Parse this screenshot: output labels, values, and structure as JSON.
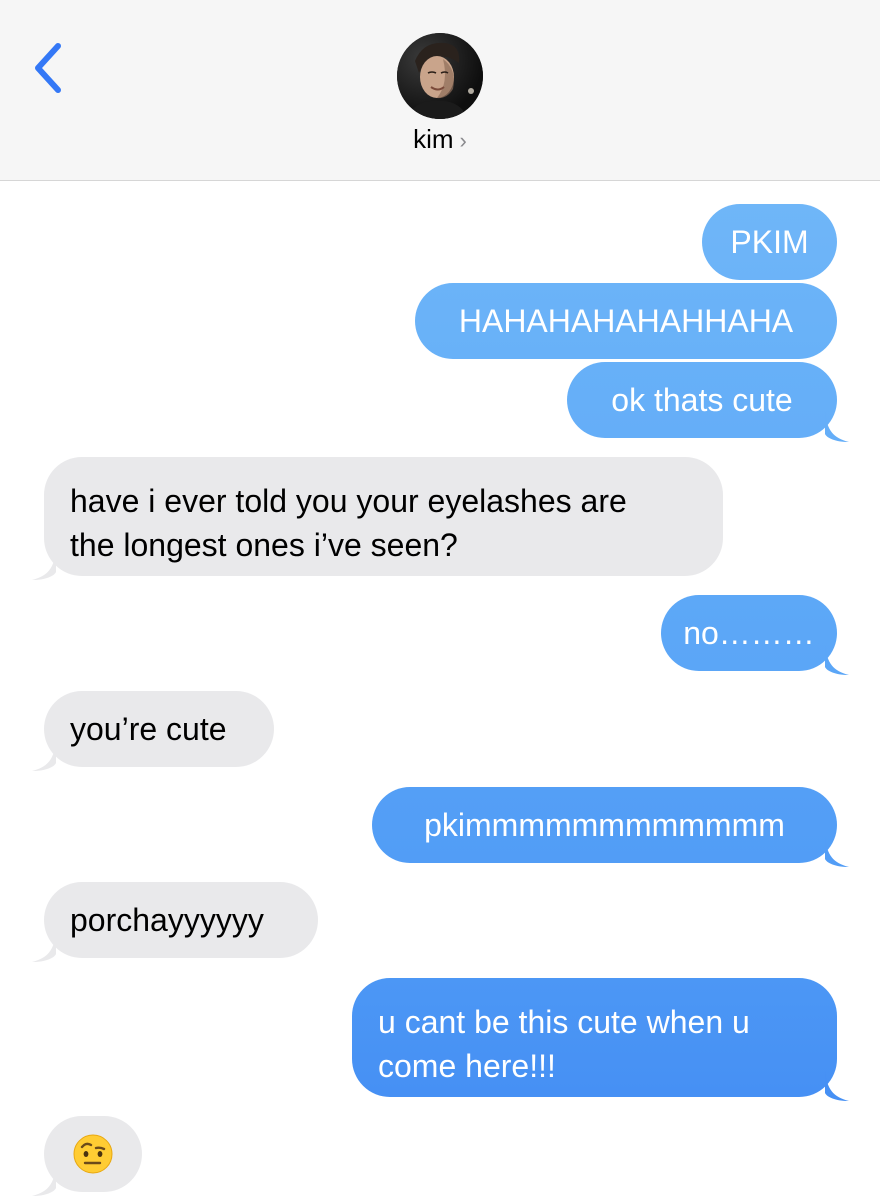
{
  "header": {
    "back_icon": "chevron-left-icon",
    "contact_name": "kim",
    "contact_chevron": "›"
  },
  "messages": [
    {
      "from": "me",
      "text": "PKIM"
    },
    {
      "from": "me",
      "text": "HAHAHAHAHAHHAHA"
    },
    {
      "from": "me",
      "text": "ok thats cute"
    },
    {
      "from": "them",
      "lines": [
        "have i ever told you your eyelashes are",
        "the longest ones i’ve seen?"
      ]
    },
    {
      "from": "me",
      "text": "no………"
    },
    {
      "from": "them",
      "text": "you’re cute"
    },
    {
      "from": "me",
      "text": "pkimmmmmmmmmmmm"
    },
    {
      "from": "them",
      "text": "porchayyyyyy"
    },
    {
      "from": "me",
      "lines": [
        "u cant be this cute when u",
        "come here!!!"
      ]
    },
    {
      "from": "them",
      "text": "🤨"
    }
  ],
  "colors": {
    "accent": "#3478f6",
    "sent_top": "#6bb3f8",
    "sent_bottom": "#3d86f2",
    "received": "#e9e9eb",
    "header_bg": "#f6f6f6"
  }
}
